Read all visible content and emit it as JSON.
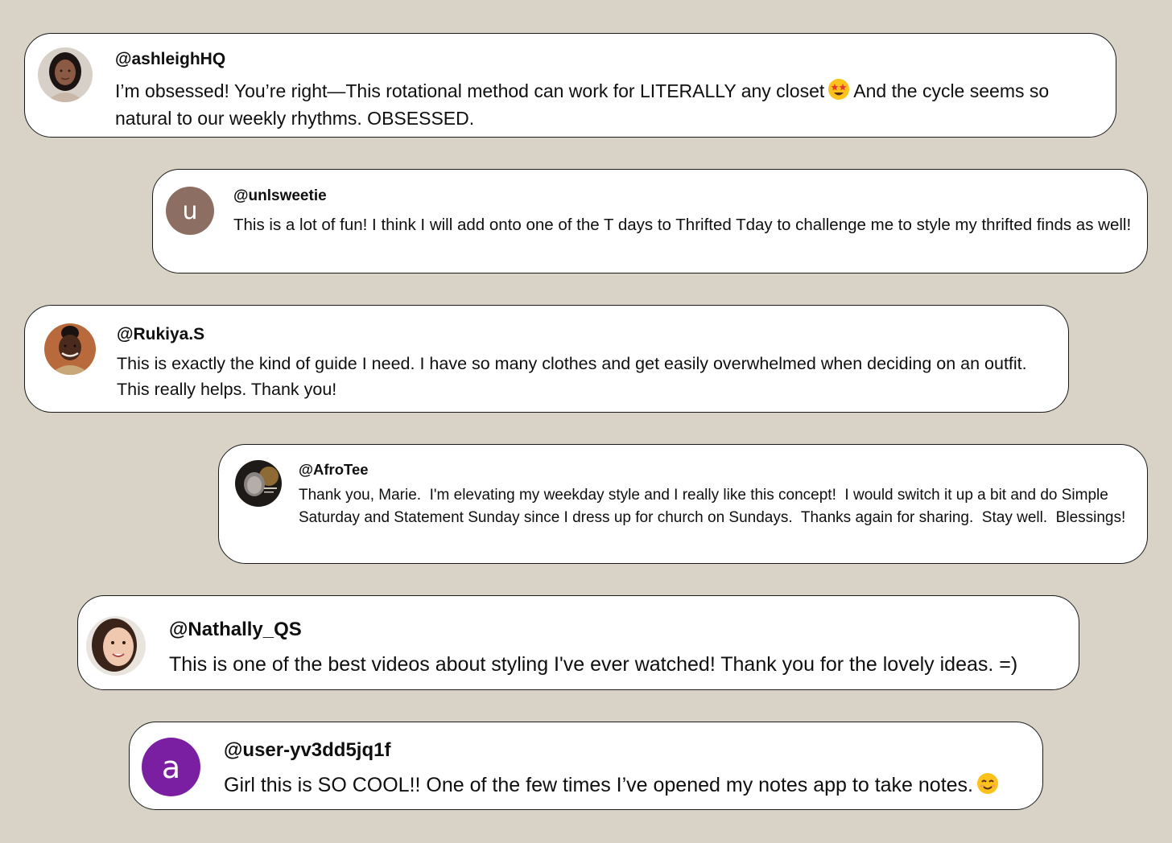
{
  "comments": [
    {
      "handle": "@ashleighHQ",
      "text_before_emoji": "I’m obsessed! You’re right—This rotational method can work for LITERALLY any closet",
      "emoji": "star-struck-emoji",
      "text_after_emoji": "And the cycle seems so natural to our weekly rhythms. OBSESSED.",
      "avatar": "photo-avatar"
    },
    {
      "handle": "@unlsweetie",
      "text": "This is a lot of fun! I think I will add onto one of the T days to Thrifted Tday to challenge me to style my thrifted finds as well!",
      "avatar_letter": "u",
      "avatar_color": "#8d6e63"
    },
    {
      "handle": "@Rukiya.S",
      "text": "This is exactly the kind of guide I need. I have so many clothes and get easily overwhelmed when deciding on an outfit. This really helps. Thank you!",
      "avatar": "photo-avatar"
    },
    {
      "handle": "@AfroTee",
      "text": "Thank you, Marie.  I'm elevating my weekday style and I really like this concept!  I would switch it up a bit and do Simple Saturday and Statement Sunday since I dress up for church on Sundays.  Thanks again for sharing.  Stay well.  Blessings!",
      "avatar": "photo-avatar"
    },
    {
      "handle": "@Nathally_QS",
      "text": "This is one of the best videos about styling I've ever watched! Thank you for the lovely ideas. =)",
      "avatar": "photo-avatar"
    },
    {
      "handle": "@user-yv3dd5jq1f",
      "text": "Girl this is SO COOL!! One of the few times I’ve opened my notes app to take notes.",
      "emoji": "smiling-face-emoji",
      "avatar_letter": "a",
      "avatar_color": "#7b1fa2"
    }
  ],
  "colors": {
    "background": "#d9d3c7",
    "card": "#ffffff",
    "border": "#1a1a1a"
  }
}
